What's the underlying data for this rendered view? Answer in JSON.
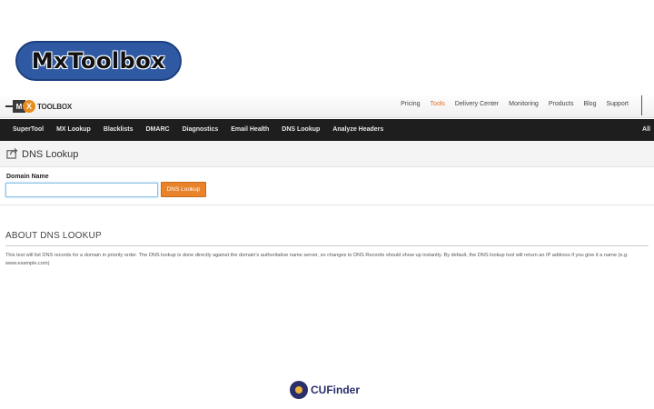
{
  "badge": {
    "text": "MxToolbox"
  },
  "logo": {
    "mx": "M",
    "x": "X",
    "word": "TOOLBOX"
  },
  "topnav": [
    {
      "label": "Pricing",
      "active": false
    },
    {
      "label": "Tools",
      "active": true
    },
    {
      "label": "Delivery Center",
      "active": false
    },
    {
      "label": "Monitoring",
      "active": false
    },
    {
      "label": "Products",
      "active": false
    },
    {
      "label": "Blog",
      "active": false
    },
    {
      "label": "Support",
      "active": false
    }
  ],
  "navbar": {
    "items": [
      "SuperTool",
      "MX Lookup",
      "Blacklists",
      "DMARC",
      "Diagnostics",
      "Email Health",
      "DNS Lookup",
      "Analyze Headers"
    ],
    "all": "All"
  },
  "page": {
    "title": "DNS Lookup",
    "icon": "share-icon"
  },
  "form": {
    "label": "Domain Name",
    "input_value": "",
    "button": "DNS Lookup"
  },
  "about": {
    "heading": "ABOUT DNS LOOKUP",
    "body": "This test will list DNS records for a domain in priority order. The DNS lookup is done directly against the domain's authoritative name server, so changes to DNS Records should show up instantly. By default, the DNS lookup tool will return an IP address if you give it a name (e.g. www.example.com)"
  },
  "watermark": {
    "text": "CUFinder"
  },
  "colors": {
    "accent": "#e8822b",
    "navbar": "#1e1e1e",
    "badge": "#2f5aa3"
  }
}
